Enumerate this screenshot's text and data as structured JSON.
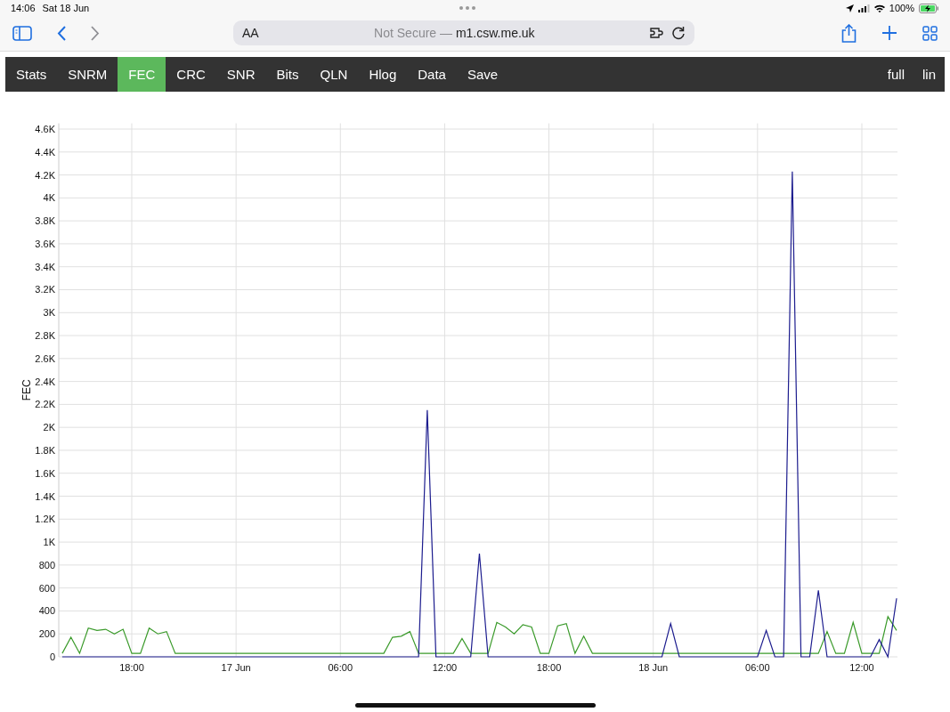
{
  "status_bar": {
    "time": "14:06",
    "date": "Sat 18 Jun",
    "battery": "100%"
  },
  "browser": {
    "text_size": "AA",
    "security": "Not Secure —",
    "domain": "m1.csw.me.uk"
  },
  "nav": {
    "items": [
      {
        "label": "Stats",
        "selected": false
      },
      {
        "label": "SNRM",
        "selected": false
      },
      {
        "label": "FEC",
        "selected": true
      },
      {
        "label": "CRC",
        "selected": false
      },
      {
        "label": "SNR",
        "selected": false
      },
      {
        "label": "Bits",
        "selected": false
      },
      {
        "label": "QLN",
        "selected": false
      },
      {
        "label": "Hlog",
        "selected": false
      },
      {
        "label": "Data",
        "selected": false
      },
      {
        "label": "Save",
        "selected": false
      }
    ],
    "options": [
      "full",
      "lin"
    ]
  },
  "chart_data": {
    "type": "line",
    "grid": true,
    "ylabel": "FEC",
    "ylim": [
      0,
      4650
    ],
    "categories": [
      null,
      null,
      null,
      null,
      null,
      null,
      null,
      null,
      "18:00",
      null,
      null,
      null,
      null,
      null,
      null,
      null,
      null,
      null,
      null,
      null,
      "17 Jun",
      null,
      null,
      null,
      null,
      null,
      null,
      null,
      null,
      null,
      null,
      null,
      "06:00",
      null,
      null,
      null,
      null,
      null,
      null,
      null,
      null,
      null,
      null,
      null,
      "12:00",
      null,
      null,
      null,
      null,
      null,
      null,
      null,
      null,
      null,
      null,
      null,
      "18:00",
      null,
      null,
      null,
      null,
      null,
      null,
      null,
      null,
      null,
      null,
      null,
      "18 Jun",
      null,
      null,
      null,
      null,
      null,
      null,
      null,
      null,
      null,
      null,
      null,
      "06:00",
      null,
      null,
      null,
      null,
      null,
      null,
      null,
      null,
      null,
      null,
      null,
      "12:00",
      null,
      null,
      null,
      null
    ],
    "series": [
      {
        "color": "#3a9a2a",
        "values": [
          30,
          170,
          30,
          250,
          230,
          240,
          200,
          240,
          30,
          30,
          250,
          200,
          220,
          30,
          30,
          30,
          30,
          30,
          30,
          30,
          30,
          30,
          30,
          30,
          30,
          30,
          30,
          30,
          30,
          30,
          30,
          30,
          30,
          30,
          30,
          30,
          30,
          30,
          170,
          180,
          220,
          30,
          30,
          30,
          30,
          30,
          160,
          30,
          30,
          30,
          300,
          260,
          200,
          280,
          260,
          30,
          30,
          270,
          290,
          30,
          180,
          30,
          30,
          30,
          30,
          30,
          30,
          30,
          30,
          30,
          30,
          30,
          30,
          30,
          30,
          30,
          30,
          30,
          30,
          30,
          30,
          30,
          30,
          30,
          30,
          30,
          30,
          30,
          220,
          30,
          30,
          300,
          30,
          30,
          30,
          350,
          230
        ]
      },
      {
        "color": "#1c1c8e",
        "values": [
          0,
          0,
          0,
          0,
          0,
          0,
          0,
          0,
          0,
          0,
          0,
          0,
          0,
          0,
          0,
          0,
          0,
          0,
          0,
          0,
          0,
          0,
          0,
          0,
          0,
          0,
          0,
          0,
          0,
          0,
          0,
          0,
          0,
          0,
          0,
          0,
          0,
          0,
          0,
          0,
          0,
          0,
          2150,
          0,
          0,
          0,
          0,
          0,
          900,
          0,
          0,
          0,
          0,
          0,
          0,
          0,
          0,
          0,
          0,
          0,
          0,
          0,
          0,
          0,
          0,
          0,
          0,
          0,
          0,
          0,
          290,
          0,
          0,
          0,
          0,
          0,
          0,
          0,
          0,
          0,
          0,
          230,
          0,
          0,
          4230,
          0,
          0,
          580,
          0,
          0,
          0,
          0,
          0,
          0,
          150,
          0,
          510
        ]
      }
    ],
    "yticks": [
      {
        "value": 0,
        "label": "0"
      },
      {
        "value": 200,
        "label": "200"
      },
      {
        "value": 400,
        "label": "400"
      },
      {
        "value": 600,
        "label": "600"
      },
      {
        "value": 800,
        "label": "800"
      },
      {
        "value": 1000,
        "label": "1K"
      },
      {
        "value": 1200,
        "label": "1.2K"
      },
      {
        "value": 1400,
        "label": "1.4K"
      },
      {
        "value": 1600,
        "label": "1.6K"
      },
      {
        "value": 1800,
        "label": "1.8K"
      },
      {
        "value": 2000,
        "label": "2K"
      },
      {
        "value": 2200,
        "label": "2.2K"
      },
      {
        "value": 2400,
        "label": "2.4K"
      },
      {
        "value": 2600,
        "label": "2.6K"
      },
      {
        "value": 2800,
        "label": "2.8K"
      },
      {
        "value": 3000,
        "label": "3K"
      },
      {
        "value": 3200,
        "label": "3.2K"
      },
      {
        "value": 3400,
        "label": "3.4K"
      },
      {
        "value": 3600,
        "label": "3.6K"
      },
      {
        "value": 3800,
        "label": "3.8K"
      },
      {
        "value": 4000,
        "label": "4K"
      },
      {
        "value": 4200,
        "label": "4.2K"
      },
      {
        "value": 4400,
        "label": "4.4K"
      },
      {
        "value": 4600,
        "label": "4.6K"
      }
    ]
  }
}
